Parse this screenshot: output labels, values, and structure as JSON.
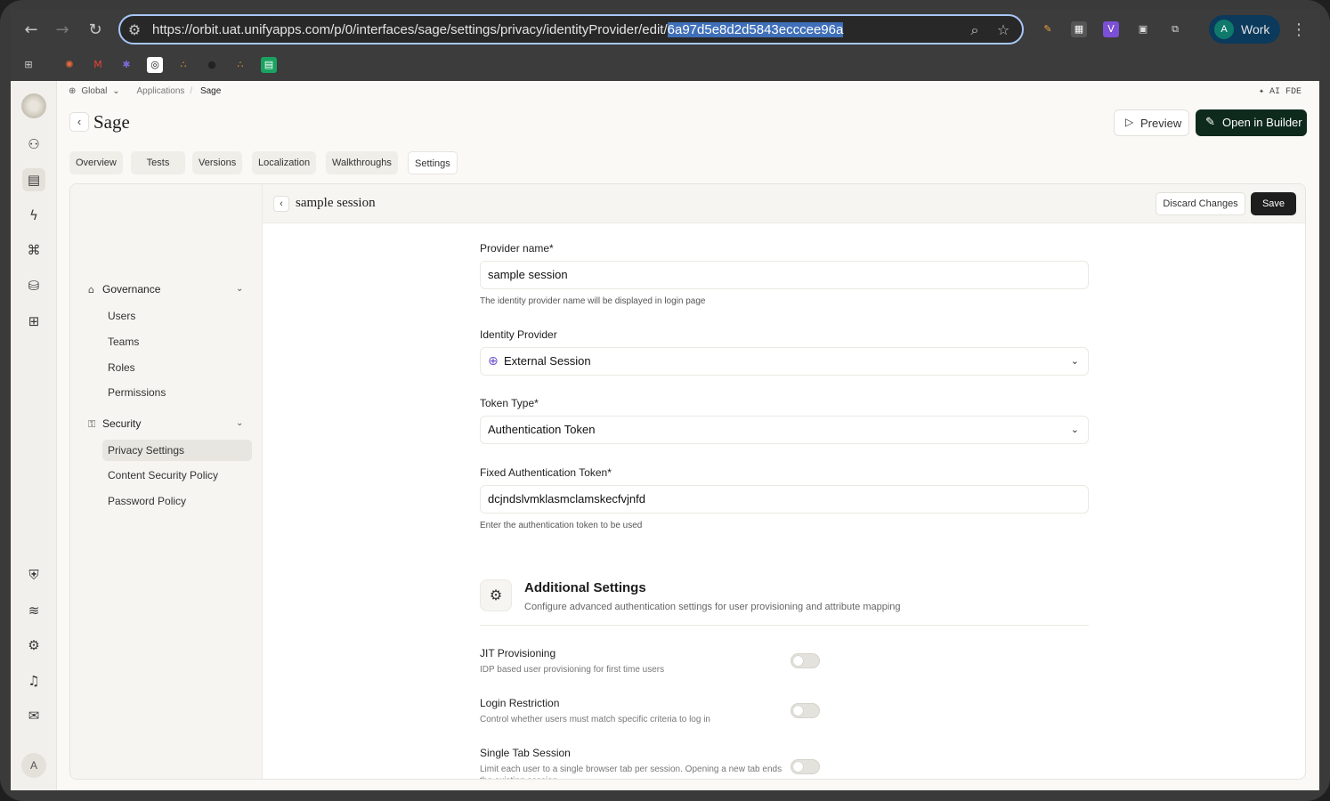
{
  "browser": {
    "url_prefix": "https://orbit.uat.unifyapps.com/p/0/interfaces/sage/settings/privacy/identityProvider/edit/",
    "url_selected": "6a97d5e8d2d5843ecccee96a",
    "profile_initial": "A",
    "profile_name": "Work"
  },
  "breadcrumb": {
    "scope": "Global",
    "section": "Applications",
    "current": "Sage"
  },
  "header": {
    "ai_label": "✦ AI FDE",
    "title": "Sage",
    "preview_label": "Preview",
    "open_label": "Open in Builder"
  },
  "tabs": [
    "Overview",
    "Tests",
    "Versions",
    "Localization",
    "Walkthroughs",
    "Settings"
  ],
  "sidebar": {
    "governance_label": "Governance",
    "governance_items": [
      "Users",
      "Teams",
      "Roles",
      "Permissions"
    ],
    "security_label": "Security",
    "security_items": [
      "Privacy Settings",
      "Content Security Policy",
      "Password Policy"
    ]
  },
  "panel": {
    "title": "sample session",
    "discard_label": "Discard Changes",
    "save_label": "Save"
  },
  "form": {
    "provider_name_label": "Provider name*",
    "provider_name_value": "sample session",
    "provider_name_help": "The identity provider name will be displayed in login page",
    "identity_provider_label": "Identity Provider",
    "identity_provider_value": "External Session",
    "token_type_label": "Token Type*",
    "token_type_value": "Authentication Token",
    "fixed_token_label": "Fixed Authentication Token*",
    "fixed_token_value": "dcjndslvmklasmclamskecfvjnfd",
    "fixed_token_help": "Enter the authentication token to be used"
  },
  "additional": {
    "title": "Additional Settings",
    "subtitle": "Configure advanced authentication settings for user provisioning and attribute mapping",
    "settings": [
      {
        "label": "JIT Provisioning",
        "desc": "IDP based user provisioning for first time users",
        "enabled": false
      },
      {
        "label": "Login Restriction",
        "desc": "Control whether users must match specific criteria to log in",
        "enabled": false
      },
      {
        "label": "Single Tab Session",
        "desc": "Limit each user to a single browser tab per session. Opening a new tab ends the existing session.",
        "enabled": false
      }
    ]
  },
  "rail": {
    "avatar_initial": "A"
  }
}
